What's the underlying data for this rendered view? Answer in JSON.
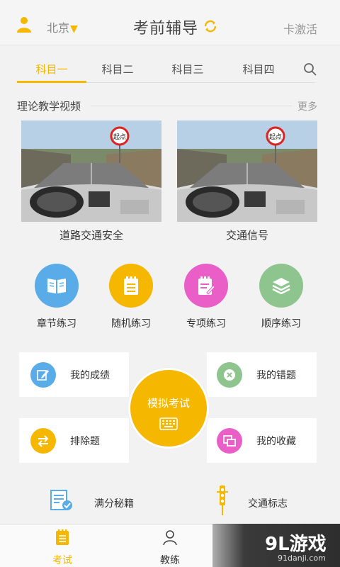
{
  "header": {
    "city": "北京",
    "city_arrow": "▼",
    "title": "考前辅导",
    "activate": "卡激活"
  },
  "tabs": [
    {
      "label": "科目一",
      "active": true
    },
    {
      "label": "科目二",
      "active": false
    },
    {
      "label": "科目三",
      "active": false
    },
    {
      "label": "科目四",
      "active": false
    }
  ],
  "videos": {
    "section_title": "理论教学视频",
    "more": "更多",
    "items": [
      {
        "label": "道路交通安全",
        "sign_text": "起点"
      },
      {
        "label": "交通信号",
        "sign_text": "起点"
      }
    ]
  },
  "practice": [
    {
      "label": "章节练习",
      "color": "#5aace8",
      "icon": "book-icon"
    },
    {
      "label": "随机练习",
      "color": "#f6b700",
      "icon": "notepad-icon"
    },
    {
      "label": "专项练习",
      "color": "#ea5ec8",
      "icon": "notepad-edit-icon"
    },
    {
      "label": "顺序练习",
      "color": "#8ec48e",
      "icon": "layers-icon"
    }
  ],
  "features": {
    "my_scores": "我的成绩",
    "my_mistakes": "我的错题",
    "exclude": "排除题",
    "favorites": "我的收藏",
    "mock_exam": "模拟考试"
  },
  "links": {
    "tips": "满分秘籍",
    "signs": "交通标志"
  },
  "bottom_nav": [
    {
      "label": "考试",
      "active": true
    },
    {
      "label": "教练",
      "active": false
    }
  ],
  "watermark": {
    "big": "9L游戏",
    "small": "91danji.com"
  },
  "colors": {
    "accent": "#f6b700",
    "blue": "#5aace8",
    "pink": "#ea5ec8",
    "green": "#8ec48e"
  }
}
